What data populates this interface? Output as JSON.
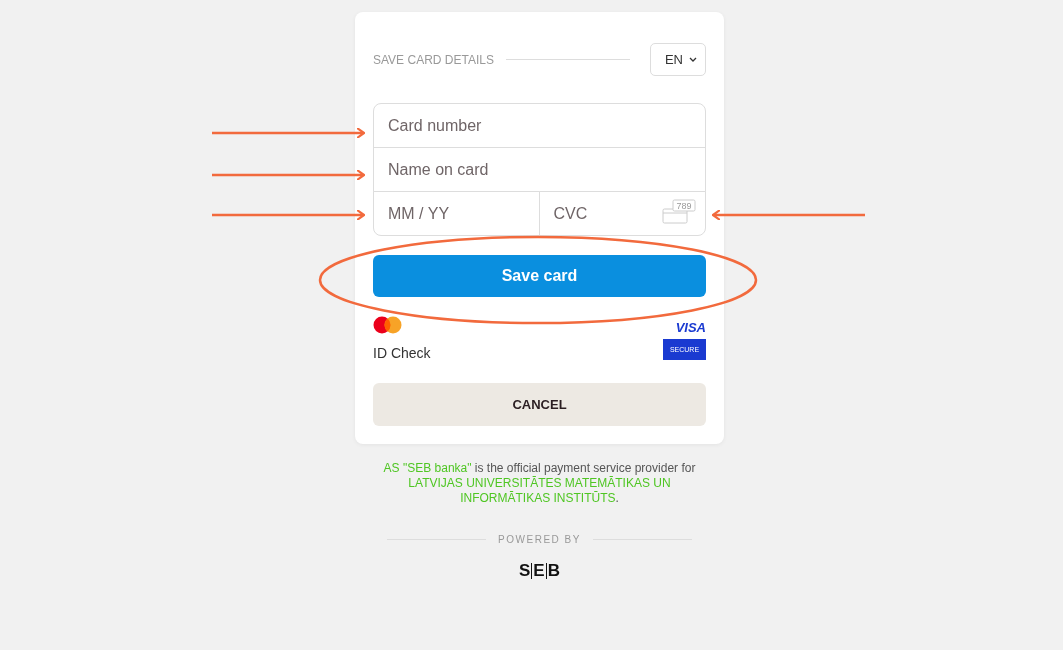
{
  "header": {
    "title": "SAVE CARD DETAILS",
    "language": "EN"
  },
  "fields": [
    {
      "placeholder": "Card number",
      "kind": "full"
    },
    {
      "placeholder": "Name on card",
      "kind": "full"
    },
    {
      "placeholder": "MM / YY",
      "kind": "half"
    },
    {
      "placeholder": "CVC",
      "kind": "cvc",
      "icon_text": "789"
    }
  ],
  "save_button": "Save card",
  "badges": {
    "mastercard": "ID Check",
    "visa": "VISA",
    "visa_secure": "SECURE"
  },
  "cancel_button": "CANCEL",
  "notice": [
    {
      "text": "AS \"SEB banka\"",
      "highlight": true
    },
    {
      "text": " is the official payment service provider for ",
      "highlight": false
    },
    {
      "text": "LATVIJAS UNIVERSITĀTES MATEMĀTIKAS UN INFORMĀTIKAS INSTITŪTS",
      "highlight": true
    },
    {
      "text": ".",
      "highlight": false
    }
  ],
  "powered_by": "POWERED BY",
  "logo": "SEB"
}
